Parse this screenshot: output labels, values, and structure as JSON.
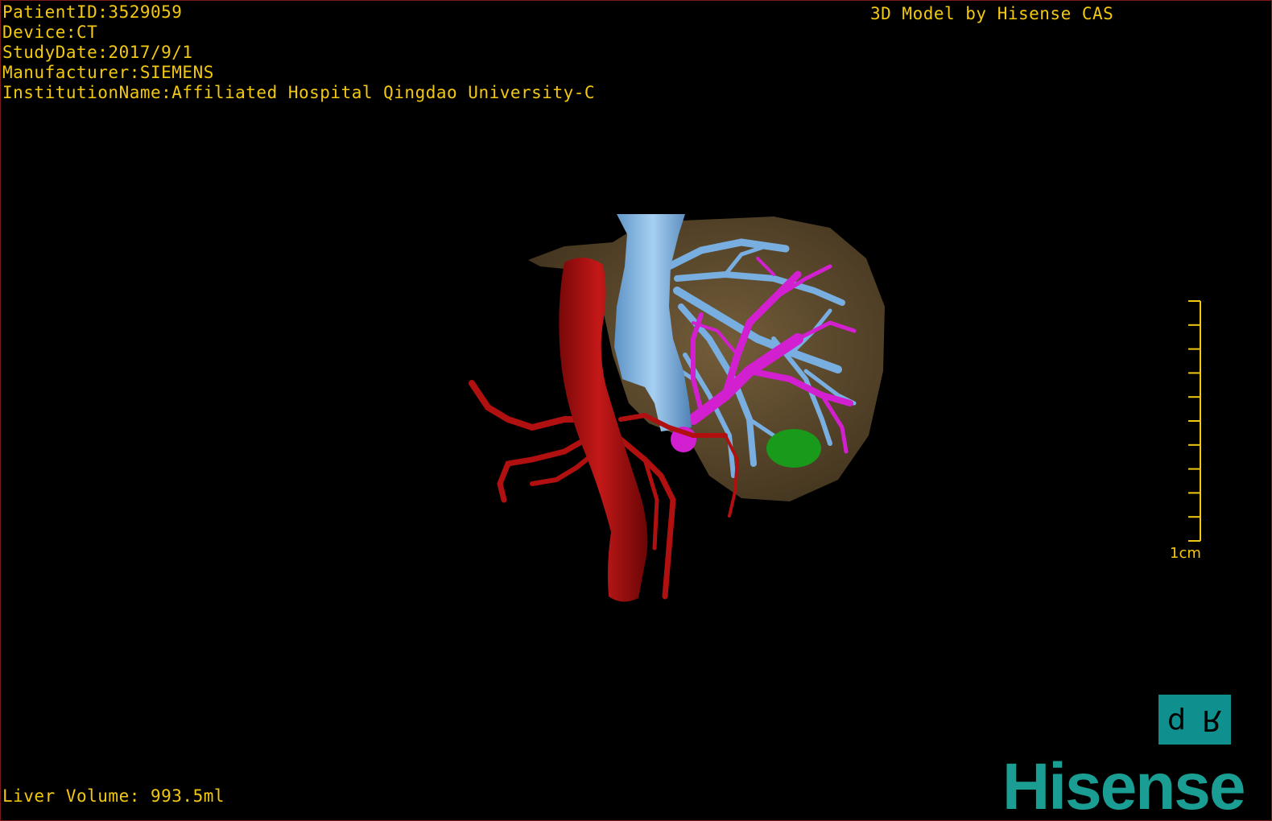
{
  "patient_info": {
    "patient_id": "PatientID:3529059",
    "device": "Device:CT",
    "study_date": "StudyDate:2017/9/1",
    "manufacturer": "Manufacturer:SIEMENS",
    "institution": "InstitutionName:Affiliated Hospital Qingdao University-C"
  },
  "brand_caption": "3D Model by Hisense CAS",
  "volume_readout": "Liver Volume: 993.5ml",
  "scale_bar": {
    "label": "1cm",
    "ticks": 10
  },
  "orientation_cube": {
    "left_face": "d",
    "right_face": "R"
  },
  "logo_text": "Hisense",
  "colors": {
    "text": "#f2c811",
    "liver": "#6b5636",
    "aorta": "#b01010",
    "hepatic_vein": "#7fb6e6",
    "portal_vein": "#d21fd0",
    "lesion": "#1a9a1a",
    "logo": "#1a9e93",
    "cube": "#0f8f8e"
  }
}
